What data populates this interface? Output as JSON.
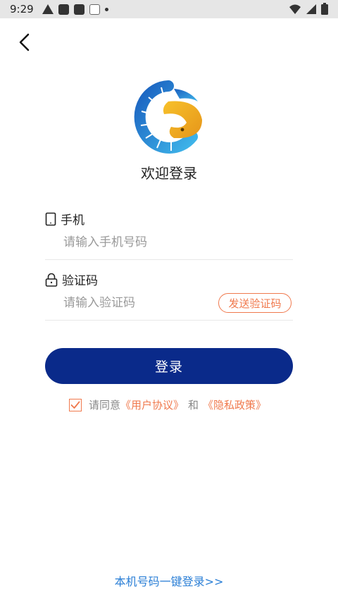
{
  "status_bar": {
    "time": "9:29"
  },
  "page": {
    "welcome": "欢迎登录"
  },
  "phone": {
    "label": "手机",
    "placeholder": "请输入手机号码"
  },
  "code": {
    "label": "验证码",
    "placeholder": "请输入验证码",
    "send_button": "发送验证码"
  },
  "login": {
    "button": "登录"
  },
  "agreement": {
    "prefix": "请同意",
    "user_agreement": "《用户协议》",
    "conjunction": "和",
    "privacy_policy": "《隐私政策》",
    "checked": true
  },
  "one_key_login": "本机号码一键登录>>",
  "colors": {
    "primary": "#0a2a8a",
    "accent": "#f0794d",
    "link_blue": "#2b7fd6"
  },
  "icons": [
    "back-arrow-icon",
    "tablet-icon",
    "lock-icon",
    "checkmark-icon",
    "app-logo-icon"
  ]
}
